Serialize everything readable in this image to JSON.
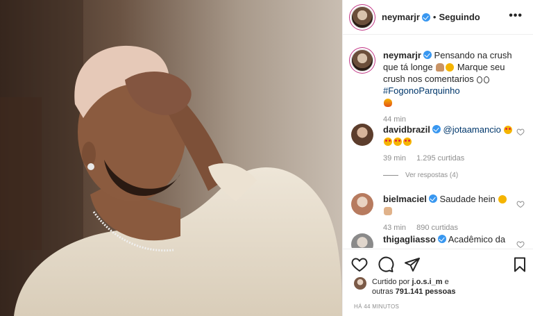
{
  "post": {
    "author": "neymarjr",
    "follow_status": "Seguindo",
    "dot": "•",
    "more": "•••"
  },
  "caption": {
    "author": "neymarjr",
    "text_1": "Pensando na crush que tá longe",
    "text_2": "Marque seu crush nos comentarios",
    "hashtag": "#FogonoParquinho",
    "time": "44 min"
  },
  "comments": [
    {
      "author": "davidbrazil",
      "mention": "@jotaamancio",
      "time": "39 min",
      "likes": "1.295 curtidas",
      "view_replies": "Ver respostas (4)"
    },
    {
      "author": "bielmaciel",
      "text": "Saudade hein",
      "time": "43 min",
      "likes": "890 curtidas"
    },
    {
      "author": "thigagliasso",
      "text": "Acadêmico da"
    }
  ],
  "likes": {
    "prefix": "Curtido por",
    "user": "j.o.s.i_m",
    "and": "e",
    "others_prefix": "outras",
    "count": "791.141 pessoas"
  },
  "timestamp": "HÁ 44 MINUTOS",
  "icons": [
    "heart-icon",
    "comment-icon",
    "share-icon",
    "bookmark-icon",
    "more-icon",
    "verified-icon"
  ]
}
